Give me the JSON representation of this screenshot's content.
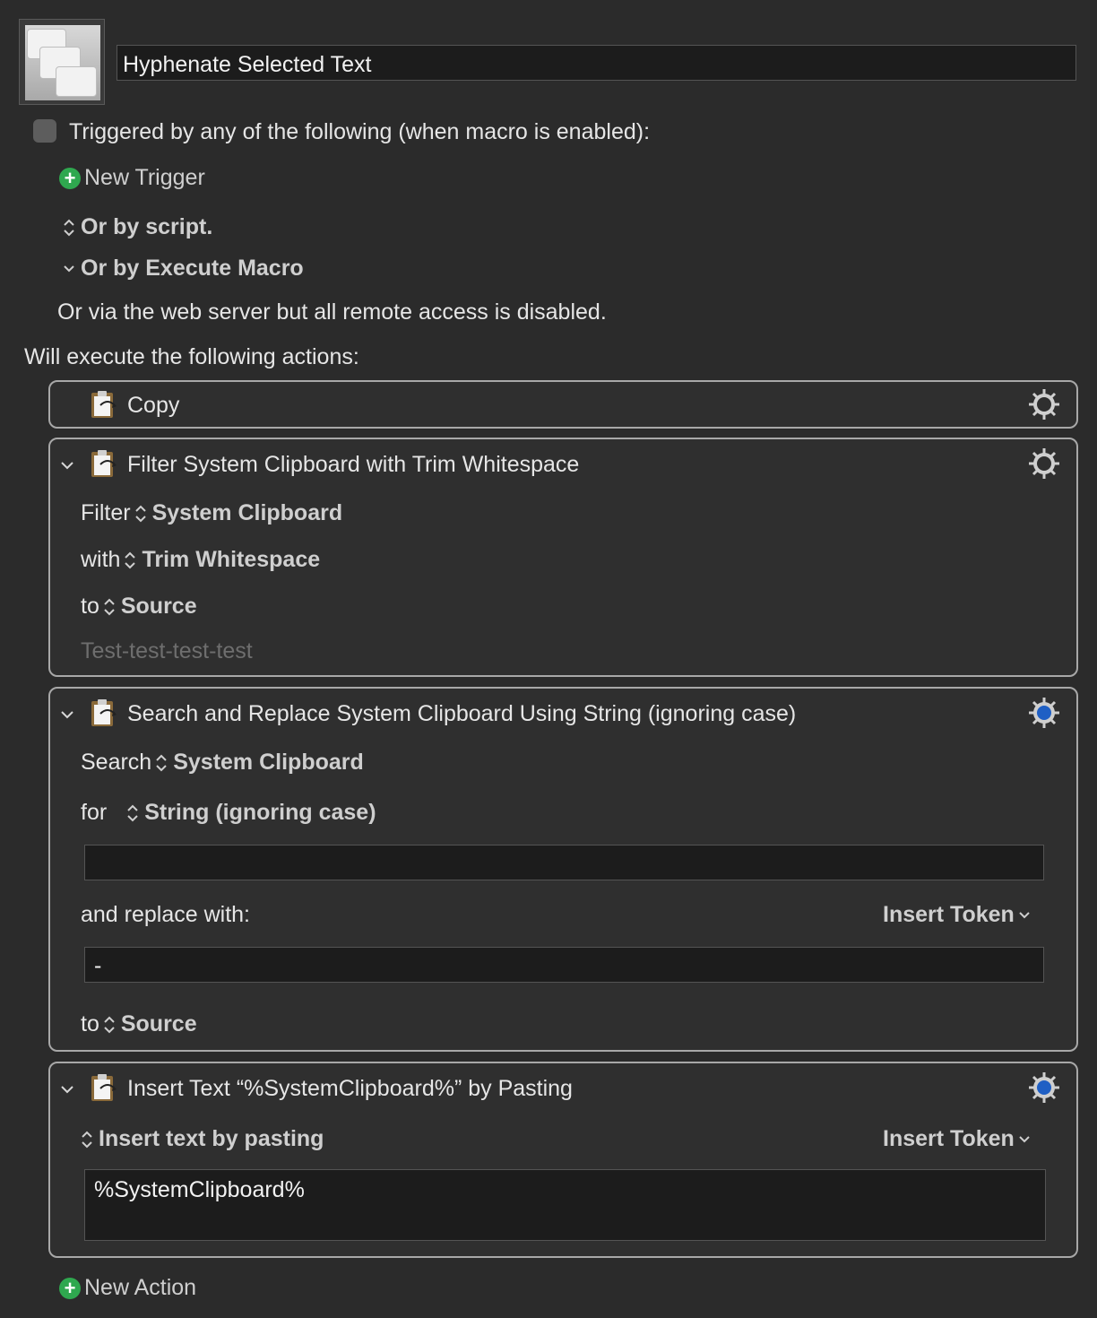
{
  "macro": {
    "icon": "macro-windows-icon",
    "name": "Hyphenate Selected Text"
  },
  "triggers": {
    "header": "Triggered by any of the following (when macro is enabled):",
    "new_trigger": "New Trigger",
    "or_by_script": "Or by script.",
    "or_by_execute_macro": "Or by Execute Macro",
    "web_server": "Or via the web server but all remote access is disabled."
  },
  "actions_header": "Will execute the following actions:",
  "actions": [
    {
      "title": "Copy"
    },
    {
      "title": "Filter System Clipboard with Trim Whitespace",
      "filter_label": "Filter",
      "filter_value": "System Clipboard",
      "with_label": "with",
      "with_value": "Trim Whitespace",
      "to_label": "to",
      "to_value": "Source",
      "preview": "Test-test-test-test"
    },
    {
      "title": "Search and Replace System Clipboard Using String (ignoring case)",
      "search_label": "Search",
      "search_value": "System Clipboard",
      "for_label": "for",
      "for_value": "String (ignoring case)",
      "search_text": "",
      "replace_label": "and replace with:",
      "insert_token": "Insert Token",
      "replace_text": "-",
      "to_label": "to",
      "to_value": "Source"
    },
    {
      "title": "Insert Text “%SystemClipboard%” by Pasting",
      "mode": "Insert text by pasting",
      "insert_token": "Insert Token",
      "text": "%SystemClipboard%"
    }
  ],
  "new_action": "New Action",
  "colors": {
    "background": "#2b2b2b",
    "field": "#1c1c1c",
    "border": "#a8a8a8",
    "gear_active": "#1f5fc4",
    "plus": "#2fa84f"
  }
}
